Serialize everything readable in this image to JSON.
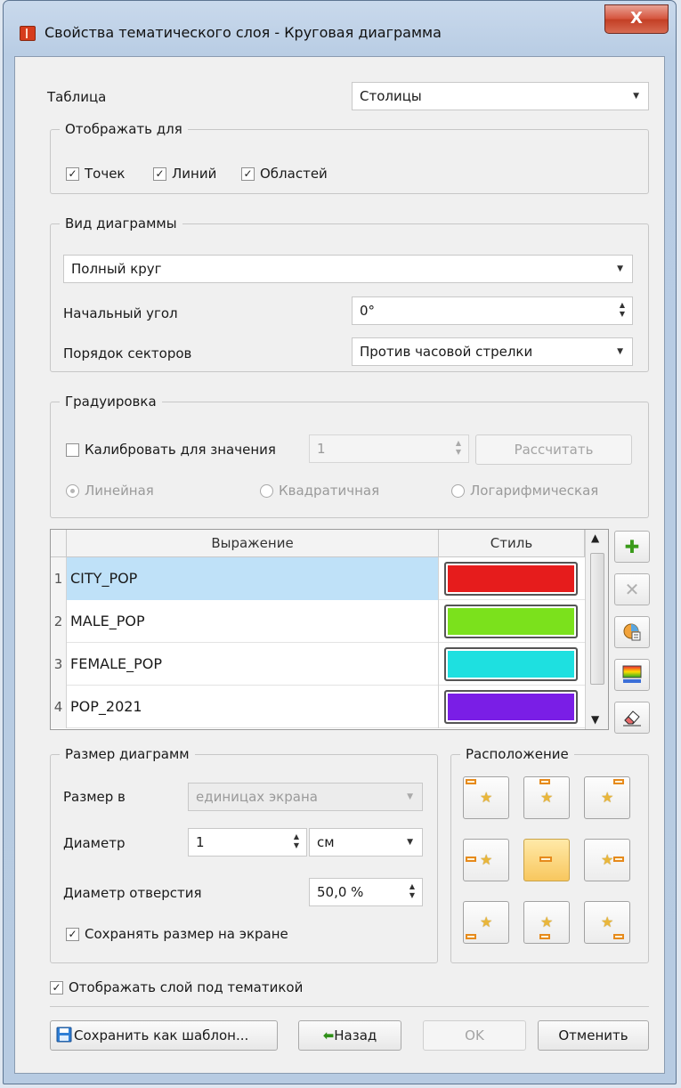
{
  "window": {
    "title": "Свойства тематического слоя - Круговая диаграмма",
    "close_label": "X",
    "close_icon": "close-icon"
  },
  "table": {
    "label": "Таблица",
    "value": "Столицы"
  },
  "display_for": {
    "legend": "Отображать для",
    "items": [
      {
        "label": "Точек",
        "checked": true
      },
      {
        "label": "Линий",
        "checked": true
      },
      {
        "label": "Областей",
        "checked": true
      }
    ]
  },
  "chart_view": {
    "legend": "Вид диаграммы",
    "type_value": "Полный круг",
    "start_angle_label": "Начальный угол",
    "start_angle_value": "0°",
    "sector_order_label": "Порядок секторов",
    "sector_order_value": "Против часовой стрелки"
  },
  "graduation": {
    "legend": "Градуировка",
    "calibrate_label": "Калибровать для значения",
    "calibrate_value": "1",
    "calculate_button": "Рассчитать",
    "scale_options": [
      {
        "label": "Линейная",
        "selected": true
      },
      {
        "label": "Квадратичная",
        "selected": false
      },
      {
        "label": "Логарифмическая",
        "selected": false
      }
    ]
  },
  "expressions": {
    "headers": {
      "expression": "Выражение",
      "style": "Стиль"
    },
    "rows": [
      {
        "num": "1",
        "expression": "CITY_POP",
        "color": "#e61c1c"
      },
      {
        "num": "2",
        "expression": "MALE_POP",
        "color": "#7be11c"
      },
      {
        "num": "3",
        "expression": "FEMALE_POP",
        "color": "#1ee0e0"
      },
      {
        "num": "4",
        "expression": "POP_2021",
        "color": "#7a1ee6"
      }
    ]
  },
  "side_tools": [
    "add-icon",
    "delete-icon",
    "palette-icon",
    "gradient-icon",
    "eraser-icon"
  ],
  "size": {
    "legend": "Размер диаграмм",
    "size_in_label": "Размер в",
    "size_in_value": "единицах экрана",
    "diameter_label": "Диаметр",
    "diameter_value": "1",
    "diameter_unit": "см",
    "hole_label": "Диаметр отверстия",
    "hole_value": "50,0 %",
    "keep_size_label": "Сохранять размер на экране",
    "keep_size_checked": true
  },
  "placement": {
    "legend": "Расположение",
    "selected_index": 4
  },
  "show_layer_label": "Отображать слой под тематикой",
  "show_layer_checked": true,
  "buttons": {
    "save_template": "Сохранить как шаблон...",
    "back": "Назад",
    "ok": "OK",
    "cancel": "Отменить"
  },
  "colors": {
    "accent_selection": "#bfe1f8",
    "active_position": "#f8c75e"
  }
}
